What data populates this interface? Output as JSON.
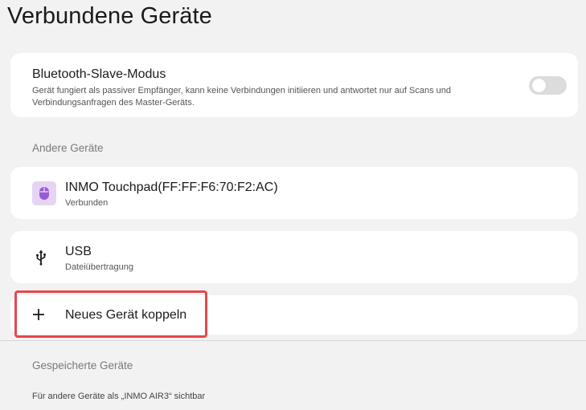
{
  "header": {
    "title": "Verbundene Geräte"
  },
  "slave_mode": {
    "title": "Bluetooth-Slave-Modus",
    "description": "Gerät fungiert als passiver Empfänger, kann keine Verbindungen initiieren und antwortet nur auf Scans und Verbindungsanfragen des Master-Geräts.",
    "enabled": false
  },
  "sections": {
    "other_devices": "Andere Geräte",
    "saved_devices": "Gespeicherte Geräte"
  },
  "devices": [
    {
      "name": "INMO Touchpad(FF:FF:F6:70:F2:AC)",
      "status": "Verbunden",
      "icon": "mouse-icon"
    },
    {
      "name": "USB",
      "status": "Dateiübertragung",
      "icon": "usb-icon"
    }
  ],
  "pair": {
    "label": "Neues Gerät koppeln",
    "icon": "plus-icon"
  },
  "footer": {
    "visibility_text": "Für andere Geräte als „INMO AIR3“ sichtbar"
  },
  "colors": {
    "background": "#f2f2f2",
    "card": "#ffffff",
    "mouse_icon_bg": "#e5d5f5",
    "mouse_icon": "#9b59d6",
    "highlight": "#e5484d",
    "toggle_off": "#dcdcdc"
  }
}
